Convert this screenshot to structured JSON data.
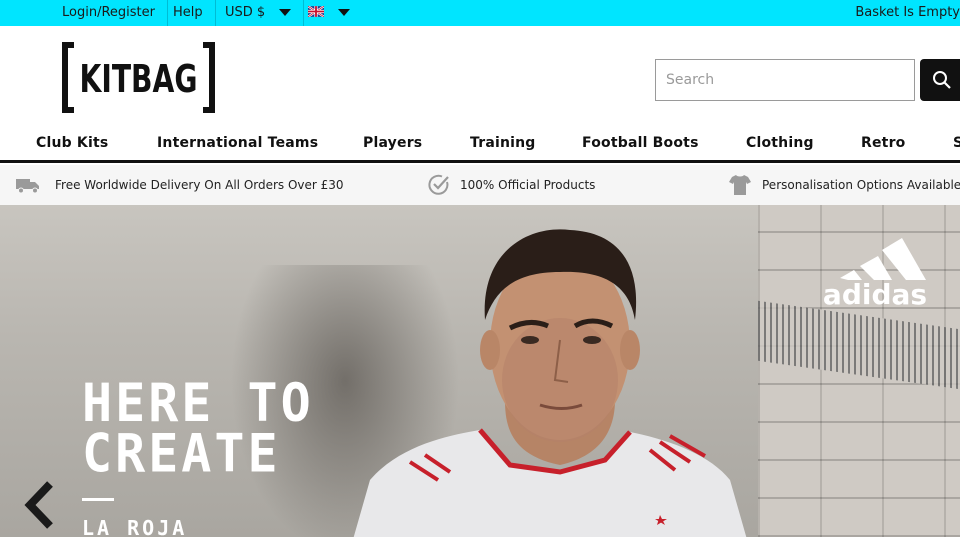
{
  "topbar": {
    "login_label": "Login/Register",
    "help_label": "Help",
    "currency_label": "USD $",
    "language_flag": "uk-flag-icon",
    "basket_label": "Basket Is Empty"
  },
  "header": {
    "logo_text": "[KITBAG]",
    "search": {
      "placeholder": "Search",
      "value": ""
    },
    "search_button_icon": "search-icon"
  },
  "nav": {
    "items": [
      {
        "label": "Club Kits"
      },
      {
        "label": "International Teams"
      },
      {
        "label": "Players"
      },
      {
        "label": "Training"
      },
      {
        "label": "Football Boots"
      },
      {
        "label": "Clothing"
      },
      {
        "label": "Retro"
      },
      {
        "label": "S"
      }
    ]
  },
  "usp": {
    "items": [
      {
        "icon": "delivery-truck-icon",
        "label": "Free Worldwide Delivery On All Orders Over £30"
      },
      {
        "icon": "check-circle-icon",
        "label": "100% Official Products"
      },
      {
        "icon": "tshirt-icon",
        "label": "Personalisation Options Available"
      }
    ]
  },
  "hero": {
    "title": "HERE TO\nCREATE",
    "subtitle": "LA ROJA",
    "brand_logo": "adidas",
    "prev_icon": "chevron-left-icon"
  },
  "colors": {
    "topbar_bg": "#00e5ff",
    "nav_underline": "#111111",
    "search_button_bg": "#111111"
  }
}
